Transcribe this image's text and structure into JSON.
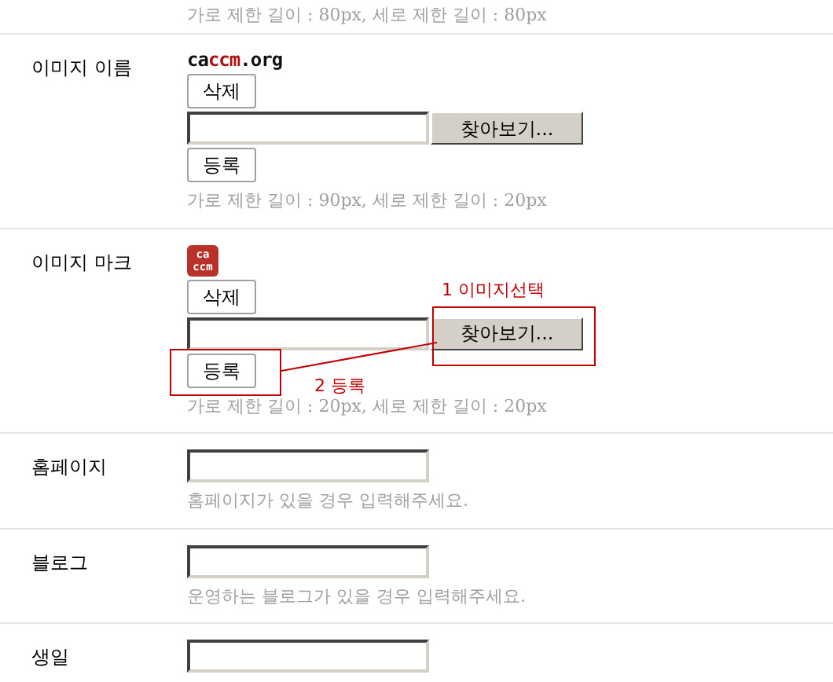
{
  "top_hint": "가로 제한 길이 : 80px, 세로 제한 길이 : 80px",
  "fields": [
    {
      "kind": "image",
      "label": "이미지 이름",
      "preview": {
        "kind": "text_logo",
        "parts": [
          {
            "text": "ca",
            "color": "#111111"
          },
          {
            "text": "ccm",
            "color": "#b01010"
          },
          {
            "text": ".org",
            "color": "#111111"
          }
        ]
      },
      "delete_button": "삭제",
      "browse_button": "찾아보기...",
      "register_button": "등록",
      "hint": "가로 제한 길이 : 90px, 세로 제한 길이 : 20px"
    },
    {
      "kind": "image",
      "label": "이미지 마크",
      "preview": {
        "kind": "badge_logo",
        "lines": [
          "ca",
          "ccm"
        ]
      },
      "delete_button": "삭제",
      "browse_button": "찾아보기...",
      "register_button": "등록",
      "hint": "가로 제한 길이 : 20px, 세로 제한 길이 : 20px",
      "annotations": [
        "1 이미지선택",
        "2 등록"
      ]
    },
    {
      "kind": "text",
      "label": "홈페이지",
      "hint": "홈페이지가 있을 경우 입력해주세요."
    },
    {
      "kind": "text",
      "label": "블로그",
      "hint": "운영하는 블로그가 있을 경우 입력해주세요."
    },
    {
      "kind": "text",
      "label": "생일"
    }
  ]
}
